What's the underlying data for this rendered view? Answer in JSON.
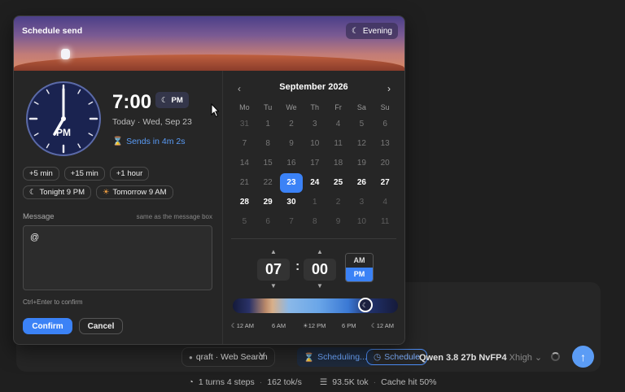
{
  "dialog": {
    "title": "Schedule send",
    "badge": "Evening"
  },
  "clock": {
    "hour": 7,
    "minute": 0,
    "face_label": "PM"
  },
  "time": {
    "display": "7:00",
    "period": "PM",
    "date_line": "Today · Wed, Sep 23",
    "sends_in": "Sends in 4m 2s"
  },
  "quick": {
    "row1": [
      "+5 min",
      "+15 min",
      "+1 hour"
    ],
    "tonight": "Tonight 9 PM",
    "tomorrow": "Tomorrow 9 AM"
  },
  "message": {
    "label": "Message",
    "hint": "same as the message box",
    "value": "@",
    "confirm_hint": "Ctrl+Enter to confirm"
  },
  "buttons": {
    "confirm": "Confirm",
    "cancel": "Cancel"
  },
  "calendar": {
    "prev": "‹",
    "next": "›",
    "title": "September 2026",
    "weekdays": [
      "Mo",
      "Tu",
      "We",
      "Th",
      "Fr",
      "Sa",
      "Su"
    ],
    "weeks": [
      [
        "31",
        "1",
        "2",
        "3",
        "4",
        "5",
        "6"
      ],
      [
        "7",
        "8",
        "9",
        "10",
        "11",
        "12",
        "13"
      ],
      [
        "14",
        "15",
        "16",
        "17",
        "18",
        "19",
        "20"
      ],
      [
        "21",
        "22",
        "23",
        "24",
        "25",
        "26",
        "27"
      ],
      [
        "28",
        "29",
        "30",
        "1",
        "2",
        "3",
        "4"
      ],
      [
        "5",
        "6",
        "7",
        "8",
        "9",
        "10",
        "11"
      ]
    ],
    "selected": "23"
  },
  "picker": {
    "hour": "07",
    "minute": "00",
    "am": "AM",
    "pm": "PM",
    "up": "▲",
    "down": "▼",
    "colon": ":"
  },
  "slider": {
    "position_fraction": 0.83,
    "labels": [
      "12 AM",
      "6 AM",
      "12 PM",
      "6 PM",
      "12 AM"
    ]
  },
  "toolbar": {
    "search_chip": "qraft · Web Search",
    "scheduling": "Scheduling...",
    "schedule_btn": "Schedule",
    "model": "Qwen 3.8 27b NvFP4",
    "model_sub": "Xhigh"
  },
  "status": {
    "turns": "1 turns 4 steps",
    "speed": "162 tok/s",
    "tokens": "93.5K tok",
    "cache": "Cache hit 50%"
  },
  "colors": {
    "accent": "#3b82f6",
    "link": "#5a9cf7"
  }
}
